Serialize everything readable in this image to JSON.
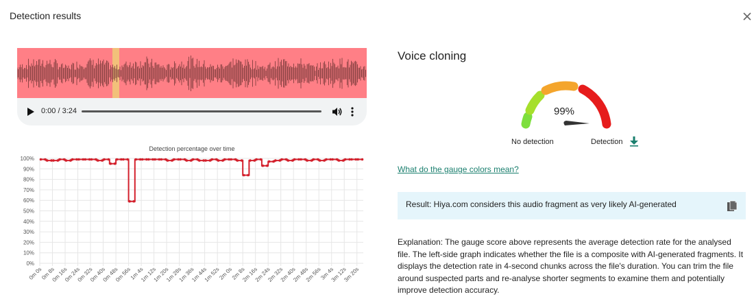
{
  "dialog": {
    "title": "Detection results",
    "close_icon": "close-icon"
  },
  "player": {
    "time": "0:00 / 3:24",
    "play_icon": "play-icon",
    "volume_icon": "volume-icon",
    "more_icon": "more-vertical-icon"
  },
  "colors": {
    "waveform_bg": "#ff7f86",
    "waveform_wave": "#7a3a3a",
    "highlight": "#f2c07a",
    "line": "#d3202c",
    "accent_green": "#1a7f6e",
    "result_bg": "#e5f5fb"
  },
  "result": {
    "section_title": "Voice cloning",
    "gauge_percent": "99%",
    "gauge_value": 0.99,
    "label_no_detection": "No detection",
    "label_detection": "Detection",
    "download_icon": "download-icon",
    "gauge_link": "What do the gauge colors mean?",
    "result_text": "Result: Hiya.com considers this audio fragment as very likely AI-generated",
    "copy_icon": "copy-icon",
    "explanation": "Explanation: The gauge score above represents the average detection rate for the analysed file. The left-side graph indicates whether the file is a composite with AI-generated fragments. It displays the detection rate in 4-second chunks across the file's duration. You can trim the file around suspected parts and re-analyse shorter segments to examine them and potentially improve detection accuracy."
  },
  "chart_data": {
    "type": "line",
    "title": "Detection percentage over time",
    "xlabel": "",
    "ylabel": "",
    "ylim": [
      0,
      100
    ],
    "y_ticks": [
      "0%",
      "10%",
      "20%",
      "30%",
      "40%",
      "50%",
      "60%",
      "70%",
      "80%",
      "90%",
      "100%"
    ],
    "grid": true,
    "x": [
      "0m 0s",
      "0m 4s",
      "0m 8s",
      "0m 12s",
      "0m 16s",
      "0m 20s",
      "0m 24s",
      "0m 28s",
      "0m 32s",
      "0m 36s",
      "0m 40s",
      "0m 44s",
      "0m 48s",
      "0m 52s",
      "0m 56s",
      "1m 0s",
      "1m 4s",
      "1m 8s",
      "1m 12s",
      "1m 16s",
      "1m 20s",
      "1m 24s",
      "1m 28s",
      "1m 32s",
      "1m 36s",
      "1m 40s",
      "1m 44s",
      "1m 48s",
      "1m 52s",
      "1m 56s",
      "2m 0s",
      "2m 4s",
      "2m 8s",
      "2m 12s",
      "2m 16s",
      "2m 20s",
      "2m 24s",
      "2m 28s",
      "2m 32s",
      "2m 36s",
      "2m 40s",
      "2m 44s",
      "2m 48s",
      "2m 52s",
      "2m 56s",
      "3m 0s",
      "3m 4s",
      "3m 8s",
      "3m 12s",
      "3m 16s",
      "3m 20s"
    ],
    "x_tick_labels": [
      "0m 0s",
      "0m 8s",
      "0m 16s",
      "0m 24s",
      "0m 32s",
      "0m 40s",
      "0m 48s",
      "0m 56s",
      "1m 4s",
      "1m 12s",
      "1m 20s",
      "1m 28s",
      "1m 36s",
      "1m 44s",
      "1m 52s",
      "2m 0s",
      "2m 8s",
      "2m 16s",
      "2m 24s",
      "2m 32s",
      "2m 40s",
      "2m 48s",
      "2m 56s",
      "3m 4s",
      "3m 12s",
      "3m 20s"
    ],
    "values": [
      99,
      98,
      98,
      99,
      98,
      99,
      99,
      99,
      99,
      98,
      99,
      95,
      99,
      99,
      59,
      99,
      99,
      99,
      99,
      99,
      98,
      99,
      99,
      98,
      99,
      98,
      98,
      99,
      98,
      99,
      99,
      98,
      84,
      98,
      99,
      93,
      97,
      98,
      99,
      98,
      99,
      99,
      98,
      99,
      98,
      99,
      99,
      98,
      99,
      99,
      99
    ]
  }
}
